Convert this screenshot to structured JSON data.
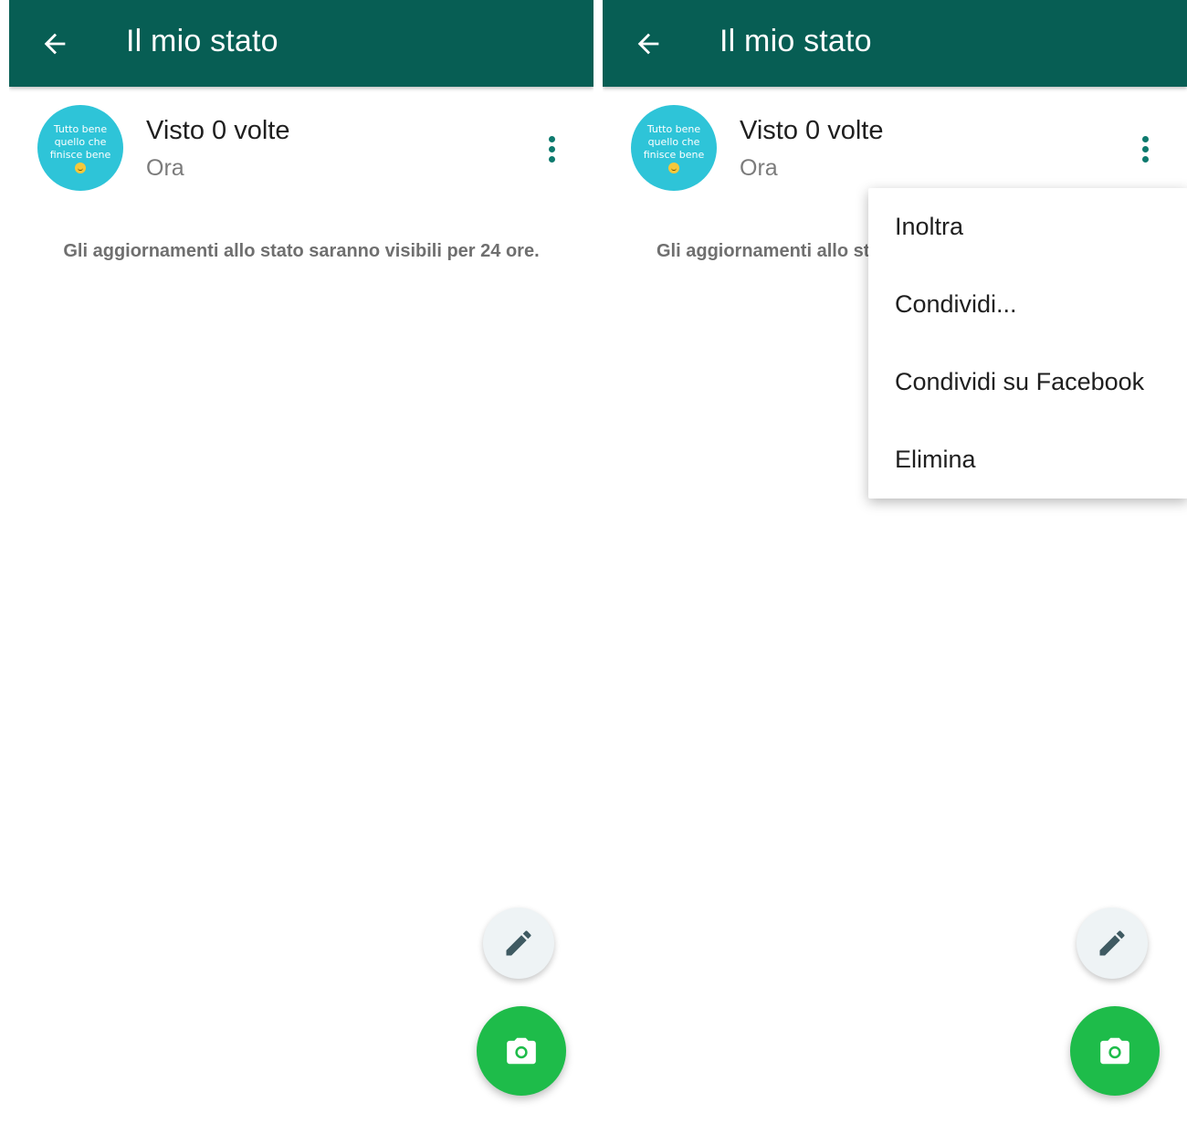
{
  "screens": [
    {
      "appbar": {
        "title": "Il mio stato",
        "back_icon": "arrow-back-icon"
      },
      "status": {
        "avatar_lines": [
          "Tutto bene",
          "quello che",
          "finisce bene"
        ],
        "avatar_emoji": "grinning-face-emoji",
        "views": "Visto 0 volte",
        "time": "Ora",
        "more_icon": "more-vert-icon"
      },
      "info": "Gli aggiornamenti allo stato saranno visibili per 24 ore.",
      "fabs": {
        "edit_icon": "pencil-icon",
        "camera_icon": "camera-icon"
      }
    },
    {
      "appbar": {
        "title": "Il mio stato",
        "back_icon": "arrow-back-icon"
      },
      "status": {
        "avatar_lines": [
          "Tutto bene",
          "quello che",
          "finisce bene"
        ],
        "avatar_emoji": "grinning-face-emoji",
        "views": "Visto 0 volte",
        "time": "Ora",
        "more_icon": "more-vert-icon"
      },
      "info": "Gli aggiornamenti allo st",
      "menu": {
        "items": [
          "Inoltra",
          "Condividi...",
          "Condividi su Facebook",
          "Elimina"
        ]
      },
      "fabs": {
        "edit_icon": "pencil-icon",
        "camera_icon": "camera-icon"
      }
    }
  ],
  "colors": {
    "appbar": "#075e54",
    "avatar": "#2ec4d8",
    "accent_icon": "#0e7a6e",
    "camera_fab": "#1ebc4a",
    "edit_fab": "#eef3f5"
  }
}
